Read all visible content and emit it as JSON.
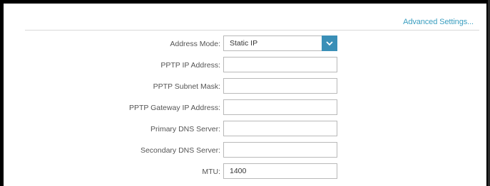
{
  "header": {
    "advanced_settings_link": "Advanced Settings..."
  },
  "form": {
    "address_mode": {
      "label": "Address Mode:",
      "value": "Static IP"
    },
    "pptp_ip_address": {
      "label": "PPTP IP Address:",
      "value": ""
    },
    "pptp_subnet_mask": {
      "label": "PPTP Subnet Mask:",
      "value": ""
    },
    "pptp_gateway_ip_address": {
      "label": "PPTP Gateway IP Address:",
      "value": ""
    },
    "primary_dns_server": {
      "label": "Primary DNS Server:",
      "value": ""
    },
    "secondary_dns_server": {
      "label": "Secondary DNS Server:",
      "value": ""
    },
    "mtu": {
      "label": "MTU:",
      "value": "1400"
    }
  },
  "colors": {
    "link": "#3a9ec0",
    "dropdown_button": "#3a8fb7",
    "label_text": "#555555",
    "field_border": "#b9b9b9"
  },
  "icons": {
    "dropdown": "chevron-down-icon"
  }
}
